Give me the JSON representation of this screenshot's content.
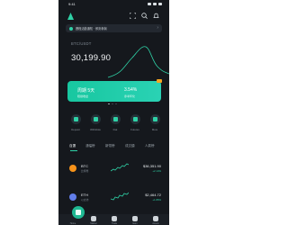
{
  "status": {
    "time": "9:41"
  },
  "notice": {
    "text": "賽程活動通知 · 即刻參與"
  },
  "ticker": {
    "pair": "BTC/USDT",
    "price": "30,199.90"
  },
  "promo": {
    "title": "周期 5天",
    "rate": "3.54%",
    "sub_left": "穩健收益",
    "sub_right": "參考年化"
  },
  "quick_actions": [
    {
      "label": "Deposit",
      "icon": "deposit-icon"
    },
    {
      "label": "Withdraw",
      "icon": "withdraw-icon"
    },
    {
      "label": "Fiat",
      "icon": "fiat-icon"
    },
    {
      "label": "Futures",
      "icon": "futures-icon"
    },
    {
      "label": "More",
      "icon": "more-icon"
    }
  ],
  "market_tabs": [
    "自選",
    "漲幅榜",
    "新幣榜",
    "成交額",
    "人氣榜"
  ],
  "coins": [
    {
      "name": "BTC",
      "sub": "比特幣",
      "price": "$36,351.90",
      "change": "+2.14%",
      "color": "#f7931a"
    },
    {
      "name": "ETH",
      "sub": "以太坊",
      "price": "$2,464.72",
      "change": "+1.86%",
      "color": "#627eea"
    }
  ],
  "nav": [
    {
      "label": "Home",
      "icon": "home-icon"
    },
    {
      "label": "Market",
      "icon": "market-icon"
    },
    {
      "label": "Trade",
      "icon": "trade-icon"
    },
    {
      "label": "Earn",
      "icon": "earn-icon"
    },
    {
      "label": "Assets",
      "icon": "wallet-icon"
    }
  ],
  "colors": {
    "accent": "#2fd1a6",
    "background": "#15181d",
    "surface": "#232830"
  }
}
